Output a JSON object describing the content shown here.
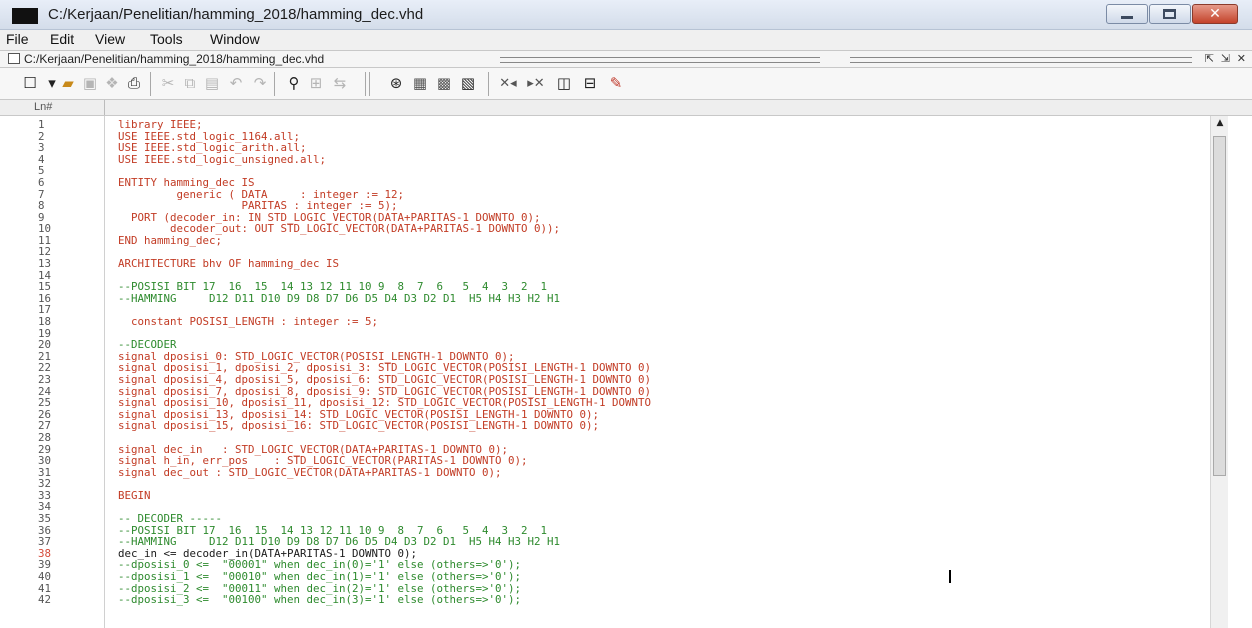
{
  "window": {
    "title": "C:/Kerjaan/Penelitian/hamming_2018/hamming_dec.vhd",
    "minimize_label": "–",
    "maximize_label": "□",
    "close_label": "✕"
  },
  "menu": [
    "File",
    "Edit",
    "View",
    "Tools",
    "Window"
  ],
  "document_tab": {
    "path": "C:/Kerjaan/Penelitian/hamming_2018/hamming_dec.vhd"
  },
  "toolbar_icons": [
    "new-file-icon",
    "open-file-icon",
    "save-icon",
    "save-all-icon",
    "print-icon",
    "cut-icon",
    "copy-icon",
    "paste-icon",
    "undo-icon",
    "redo-icon",
    "find-icon",
    "find-next-icon",
    "replace-icon",
    "compile-icon",
    "compile-all-icon",
    "simulate-icon",
    "break-icon",
    "comment-icon",
    "uncomment-icon",
    "indent-icon",
    "outdent-icon",
    "clear-icon"
  ],
  "editor": {
    "line_header": "Ln#",
    "current_line": 38,
    "lines": [
      {
        "n": "1",
        "t": "library IEEE;",
        "k": "kw"
      },
      {
        "n": "2",
        "t": "USE IEEE.std_logic_1164.all;",
        "k": "kw"
      },
      {
        "n": "3",
        "t": "USE IEEE.std_logic_arith.all;",
        "k": "kw"
      },
      {
        "n": "4",
        "t": "USE IEEE.std_logic_unsigned.all;",
        "k": "kw"
      },
      {
        "n": "5",
        "t": "",
        "k": "kw"
      },
      {
        "n": "6",
        "t": "ENTITY hamming_dec IS",
        "k": "kw"
      },
      {
        "n": "7",
        "t": "         generic ( DATA     : integer := 12;",
        "k": "kw"
      },
      {
        "n": "8",
        "t": "                   PARITAS : integer := 5);",
        "k": "kw"
      },
      {
        "n": "9",
        "t": "  PORT (decoder_in: IN STD_LOGIC_VECTOR(DATA+PARITAS-1 DOWNTO 0);",
        "k": "kw"
      },
      {
        "n": "10",
        "t": "        decoder_out: OUT STD_LOGIC_VECTOR(DATA+PARITAS-1 DOWNTO 0));",
        "k": "kw"
      },
      {
        "n": "11",
        "t": "END hamming_dec;",
        "k": "kw"
      },
      {
        "n": "12",
        "t": "",
        "k": "kw"
      },
      {
        "n": "13",
        "t": "ARCHITECTURE bhv OF hamming_dec IS",
        "k": "kw"
      },
      {
        "n": "14",
        "t": "",
        "k": "kw"
      },
      {
        "n": "15",
        "t": "--POSISI BIT 17  16  15  14 13 12 11 10 9  8  7  6   5  4  3  2  1",
        "k": "cmt"
      },
      {
        "n": "16",
        "t": "--HAMMING     D12 D11 D10 D9 D8 D7 D6 D5 D4 D3 D2 D1  H5 H4 H3 H2 H1",
        "k": "cmt"
      },
      {
        "n": "17",
        "t": "",
        "k": "kw"
      },
      {
        "n": "18",
        "t": "  constant POSISI_LENGTH : integer := 5;",
        "k": "kw"
      },
      {
        "n": "19",
        "t": "",
        "k": "kw"
      },
      {
        "n": "20",
        "t": "--DECODER",
        "k": "cmt"
      },
      {
        "n": "21",
        "t": "signal dposisi_0: STD_LOGIC_VECTOR(POSISI_LENGTH-1 DOWNTO 0);",
        "k": "kw"
      },
      {
        "n": "22",
        "t": "signal dposisi_1, dposisi_2, dposisi_3: STD_LOGIC_VECTOR(POSISI_LENGTH-1 DOWNTO 0)",
        "k": "kw"
      },
      {
        "n": "23",
        "t": "signal dposisi_4, dposisi_5, dposisi_6: STD_LOGIC_VECTOR(POSISI_LENGTH-1 DOWNTO 0)",
        "k": "kw"
      },
      {
        "n": "24",
        "t": "signal dposisi_7, dposisi_8, dposisi_9: STD_LOGIC_VECTOR(POSISI_LENGTH-1 DOWNTO 0)",
        "k": "kw"
      },
      {
        "n": "25",
        "t": "signal dposisi_10, dposisi_11, dposisi_12: STD_LOGIC_VECTOR(POSISI_LENGTH-1 DOWNTO",
        "k": "kw"
      },
      {
        "n": "26",
        "t": "signal dposisi_13, dposisi_14: STD_LOGIC_VECTOR(POSISI_LENGTH-1 DOWNTO 0);",
        "k": "kw"
      },
      {
        "n": "27",
        "t": "signal dposisi_15, dposisi_16: STD_LOGIC_VECTOR(POSISI_LENGTH-1 DOWNTO 0);",
        "k": "kw"
      },
      {
        "n": "28",
        "t": "",
        "k": "kw"
      },
      {
        "n": "29",
        "t": "signal dec_in   : STD_LOGIC_VECTOR(DATA+PARITAS-1 DOWNTO 0);",
        "k": "kw"
      },
      {
        "n": "30",
        "t": "signal h_in, err_pos    : STD_LOGIC_VECTOR(PARITAS-1 DOWNTO 0);",
        "k": "kw"
      },
      {
        "n": "31",
        "t": "signal dec_out : STD_LOGIC_VECTOR(DATA+PARITAS-1 DOWNTO 0);",
        "k": "kw"
      },
      {
        "n": "32",
        "t": "",
        "k": "kw"
      },
      {
        "n": "33",
        "t": "BEGIN",
        "k": "kw"
      },
      {
        "n": "34",
        "t": "",
        "k": "kw"
      },
      {
        "n": "35",
        "t": "-- DECODER -----",
        "k": "cmt"
      },
      {
        "n": "36",
        "t": "--POSISI BIT 17  16  15  14 13 12 11 10 9  8  7  6   5  4  3  2  1",
        "k": "cmt"
      },
      {
        "n": "37",
        "t": "--HAMMING     D12 D11 D10 D9 D8 D7 D6 D5 D4 D3 D2 D1  H5 H4 H3 H2 H1",
        "k": "cmt"
      },
      {
        "n": "38",
        "t": "dec_in <= decoder_in(DATA+PARITAS-1 DOWNTO 0);",
        "k": "dark"
      },
      {
        "n": "39",
        "t": "--dposisi_0 <=  \"00001\" when dec_in(0)='1' else (others=>'0');",
        "k": "cmt"
      },
      {
        "n": "40",
        "t": "--dposisi_1 <=  \"00010\" when dec_in(1)='1' else (others=>'0');",
        "k": "cmt"
      },
      {
        "n": "41",
        "t": "--dposisi_2 <=  \"00011\" when dec_in(2)='1' else (others=>'0');",
        "k": "cmt"
      },
      {
        "n": "42",
        "t": "--dposisi_3 <=  \"00100\" when dec_in(3)='1' else (others=>'0');",
        "k": "cmt"
      }
    ]
  }
}
